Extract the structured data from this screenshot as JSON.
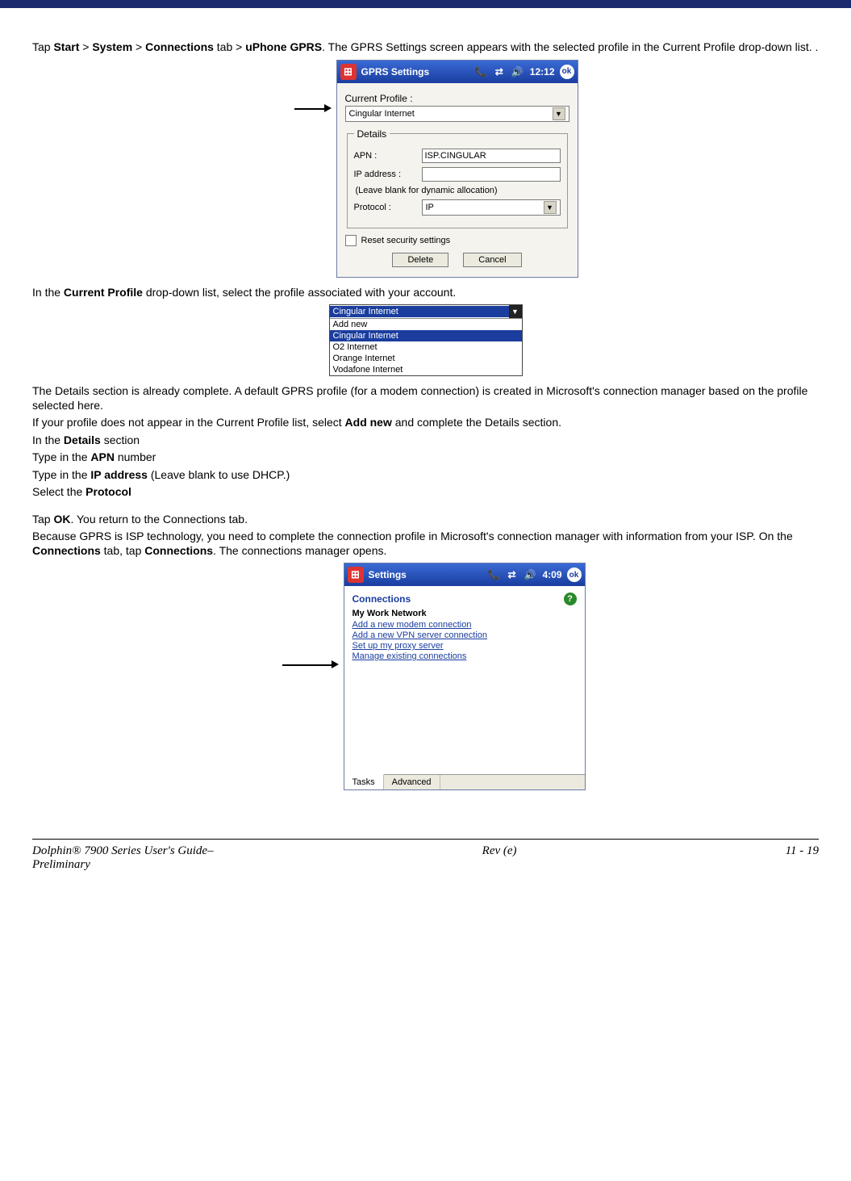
{
  "para1": {
    "t1": "Tap ",
    "b1": "Start",
    "gt1": " > ",
    "b2": "System",
    "gt2": " > ",
    "b3": "Connections",
    "t2": " tab > ",
    "b4": "uPhone GPRS",
    "t3": ". The GPRS Settings screen appears with the selected profile in the Current Profile drop-down list. ."
  },
  "gprs_window": {
    "title": "GPRS Settings",
    "time": "12:12",
    "ok": "ok",
    "current_profile_label": "Current Profile :",
    "profile_value": "Cingular Internet",
    "details_legend": "Details",
    "apn_label": "APN :",
    "apn_value": "ISP.CINGULAR",
    "ip_label": "IP address :",
    "ip_value": "",
    "hint": "(Leave blank for dynamic allocation)",
    "protocol_label": "Protocol :",
    "protocol_value": "IP",
    "reset_label": "Reset security settings",
    "delete_btn": "Delete",
    "cancel_btn": "Cancel"
  },
  "para2": {
    "t1": "In the ",
    "b1": "Current Profile",
    "t2": " drop-down list, select the profile associated with your account."
  },
  "ddopen": {
    "selected": "Cingular Internet",
    "opts": [
      "Add new",
      "Cingular Internet",
      "O2 Internet",
      "Orange Internet",
      "Vodafone Internet"
    ]
  },
  "para3": "The Details section is already complete. A default GPRS profile (for a modem connection) is created in Microsoft's connection manager based on the profile selected here.",
  "para4": {
    "t1": "If your profile does not appear in the Current Profile list, select ",
    "b1": "Add new",
    "t2": " and complete the Details section."
  },
  "para5": {
    "t1": "In the ",
    "b1": "Details",
    "t2": " section"
  },
  "para6": {
    "t1": "Type in the ",
    "b1": "APN",
    "t2": " number"
  },
  "para7": {
    "t1": "Type in the ",
    "b1": "IP address",
    "t2": " (Leave blank to use DHCP.)"
  },
  "para8": {
    "t1": "Select the ",
    "b1": "Protocol"
  },
  "para9": {
    "t1": "Tap ",
    "b1": "OK",
    "t2": ". You return to the Connections tab."
  },
  "para10": {
    "t1": "Because GPRS is ISP technology, you need to complete the connection profile in Microsoft's connection manager with information from your ISP. On the ",
    "b1": "Connections",
    "t2": " tab, tap ",
    "b2": "Connections",
    "t3": ". The connections manager opens."
  },
  "conns_window": {
    "title": "Settings",
    "time": "4:09",
    "ok": "ok",
    "heading": "Connections",
    "group": "My Work Network",
    "links": [
      "Add a new modem connection",
      "Add a new VPN server connection",
      "Set up my proxy server",
      "Manage existing connections"
    ],
    "tabs": [
      "Tasks",
      "Advanced"
    ]
  },
  "footer": {
    "left1": "Dolphin® 7900 Series User's Guide–",
    "left2": "Preliminary",
    "center": "Rev (e)",
    "right": "11 - 19"
  }
}
